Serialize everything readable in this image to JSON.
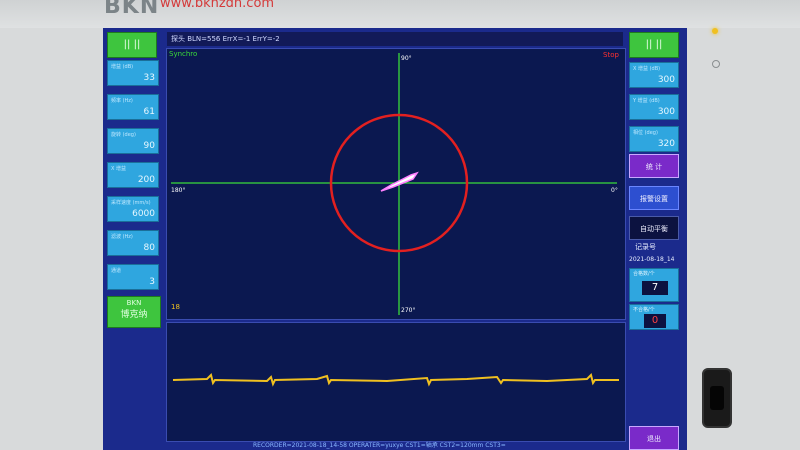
{
  "device": {
    "brand": "BKN",
    "url": "www.bknzdh.com"
  },
  "screen": {
    "top_left_button": "|| ||",
    "top_right_button": "|| ||",
    "info_bar": "探头 BLN=556 ErrX=-1 ErrY=-2",
    "scope": {
      "mode_label": "Synchro",
      "state_label": "Stop",
      "angle_top": "90°",
      "angle_left": "180°",
      "angle_right": "0°",
      "angle_bottom": "270°",
      "gain_marker": "18"
    },
    "left_params": [
      {
        "label": "增益 (dB)",
        "value": "33"
      },
      {
        "label": "频率 (Hz)",
        "value": "61"
      },
      {
        "label": "旋转 (deg)",
        "value": "90"
      },
      {
        "label": "X 增益",
        "value": "200"
      },
      {
        "label": "采样速度 (mm/s)",
        "value": "6000"
      },
      {
        "label": "滤波 (Hz)",
        "value": "80"
      },
      {
        "label": "通道",
        "value": "3"
      }
    ],
    "logo": {
      "latin": "BKN",
      "chinese": "博克纳"
    },
    "right_params": [
      {
        "label": "X 增益 (dB)",
        "value": "300"
      },
      {
        "label": "Y 增益 (dB)",
        "value": "300"
      },
      {
        "label": "相位 (deg)",
        "value": "320"
      }
    ],
    "right_buttons": {
      "stats": "统 计",
      "settings": "报警设置",
      "auto_balance": "自动平衡",
      "record_label": "记录号",
      "record_value": "2021-08-18_14",
      "count_label": "合格数/个",
      "count_value": "7",
      "defect_label": "不合格/个",
      "defect_value": "0",
      "exit": "退出"
    },
    "status_bar": "RECORDER=2021-08-18_14-58   OPERATER=yuxye   CST1=轴承   CST2=120mm   CST3="
  },
  "colors": {
    "screen_bg": "#1b2a8c",
    "panel": "#2fa6df",
    "accent_green": "#3ec53e",
    "ring": "#e32020",
    "crosshair": "#3adb3a",
    "trace": "#f0c020"
  }
}
